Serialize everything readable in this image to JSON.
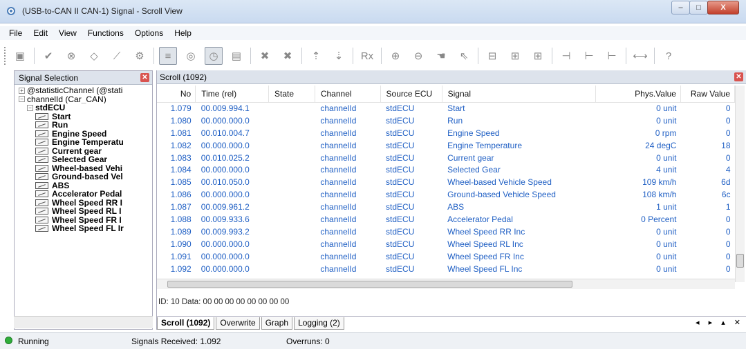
{
  "window": {
    "title": "(USB-to-CAN II  CAN-1) Signal - Scroll View",
    "buttons": [
      "–",
      "□",
      "X"
    ]
  },
  "menu": [
    "File",
    "Edit",
    "View",
    "Functions",
    "Options",
    "Help"
  ],
  "toolbar": [
    {
      "icon": "save-icon",
      "glyph": "▣"
    },
    {
      "icon": "check-icon",
      "glyph": "✔"
    },
    {
      "icon": "stop-icon",
      "glyph": "⊗"
    },
    {
      "icon": "eraser-icon",
      "glyph": "◇"
    },
    {
      "icon": "wand-icon",
      "glyph": "⟋"
    },
    {
      "icon": "tools-icon",
      "glyph": "⚙"
    },
    {
      "icon": "scroll-mode-icon",
      "glyph": "≡",
      "active": true
    },
    {
      "icon": "overwrite-icon",
      "glyph": "◎"
    },
    {
      "icon": "clock-icon",
      "glyph": "◷",
      "active": true
    },
    {
      "icon": "export-icon",
      "glyph": "▤"
    },
    {
      "icon": "delete-icon",
      "glyph": "✖"
    },
    {
      "icon": "delete-all-icon",
      "glyph": "✖"
    },
    {
      "icon": "up-icon",
      "glyph": "⇡"
    },
    {
      "icon": "down-icon",
      "glyph": "⇣"
    },
    {
      "icon": "rx-icon",
      "glyph": "Rx"
    },
    {
      "icon": "zoom-in-icon",
      "glyph": "⊕"
    },
    {
      "icon": "zoom-out-icon",
      "glyph": "⊖"
    },
    {
      "icon": "hand-icon",
      "glyph": "☚"
    },
    {
      "icon": "pointer-icon",
      "glyph": "⇖"
    },
    {
      "icon": "fit-icon",
      "glyph": "⊟"
    },
    {
      "icon": "fit-h-icon",
      "glyph": "⊞"
    },
    {
      "icon": "fit-v-icon",
      "glyph": "⊞"
    },
    {
      "icon": "cursor-icon",
      "glyph": "⊣"
    },
    {
      "icon": "cursor1-icon",
      "glyph": "⊢"
    },
    {
      "icon": "cursor2-icon",
      "glyph": "⊢"
    },
    {
      "icon": "distance-icon",
      "glyph": "⟷"
    },
    {
      "icon": "help-icon",
      "glyph": "?"
    }
  ],
  "left_panel": {
    "title": "Signal Selection",
    "tree": [
      {
        "label": "@statisticChannel  (@stati",
        "level": 0,
        "expander": "+",
        "bold": false
      },
      {
        "label": "channelId  (Car_CAN)",
        "level": 0,
        "expander": "−",
        "bold": false
      },
      {
        "label": "stdECU",
        "level": 1,
        "expander": "−",
        "bold": true
      },
      {
        "label": "Start",
        "level": 2,
        "bold": true
      },
      {
        "label": "Run",
        "level": 2,
        "bold": true
      },
      {
        "label": "Engine Speed",
        "level": 2,
        "bold": true
      },
      {
        "label": "Engine Temperatu",
        "level": 2,
        "bold": true
      },
      {
        "label": "Current gear",
        "level": 2,
        "bold": true
      },
      {
        "label": "Selected Gear",
        "level": 2,
        "bold": true
      },
      {
        "label": "Wheel-based Vehi",
        "level": 2,
        "bold": true
      },
      {
        "label": "Ground-based Vel",
        "level": 2,
        "bold": true
      },
      {
        "label": "ABS",
        "level": 2,
        "bold": true
      },
      {
        "label": "Accelerator Pedal",
        "level": 2,
        "bold": true
      },
      {
        "label": "Wheel Speed RR I",
        "level": 2,
        "bold": true
      },
      {
        "label": "Wheel Speed RL I",
        "level": 2,
        "bold": true
      },
      {
        "label": "Wheel Speed FR I",
        "level": 2,
        "bold": true
      },
      {
        "label": "Wheel Speed FL Ir",
        "level": 2,
        "bold": true
      }
    ],
    "hscroll_label": "III"
  },
  "scroll_panel": {
    "title": "Scroll (1092)",
    "columns": [
      "No",
      "Time (rel)",
      "State",
      "Channel",
      "Source ECU",
      "Signal",
      "Phys.Value",
      "Raw Value"
    ],
    "rows": [
      [
        "1.079",
        "00.009.994.1",
        "",
        "channelId",
        "stdECU",
        "Start",
        "0 unit",
        "0"
      ],
      [
        "1.080",
        "00.000.000.0",
        "",
        "channelId",
        "stdECU",
        "Run",
        "0 unit",
        "0"
      ],
      [
        "1.081",
        "00.010.004.7",
        "",
        "channelId",
        "stdECU",
        "Engine Speed",
        "0 rpm",
        "0"
      ],
      [
        "1.082",
        "00.000.000.0",
        "",
        "channelId",
        "stdECU",
        "Engine Temperature",
        "24 degC",
        "18"
      ],
      [
        "1.083",
        "00.010.025.2",
        "",
        "channelId",
        "stdECU",
        "Current gear",
        "0 unit",
        "0"
      ],
      [
        "1.084",
        "00.000.000.0",
        "",
        "channelId",
        "stdECU",
        "Selected Gear",
        "4 unit",
        "4"
      ],
      [
        "1.085",
        "00.010.050.0",
        "",
        "channelId",
        "stdECU",
        "Wheel-based Vehicle Speed",
        "109 km/h",
        "6d"
      ],
      [
        "1.086",
        "00.000.000.0",
        "",
        "channelId",
        "stdECU",
        "Ground-based Vehicle Speed",
        "108 km/h",
        "6c"
      ],
      [
        "1.087",
        "00.009.961.2",
        "",
        "channelId",
        "stdECU",
        "ABS",
        "1 unit",
        "1"
      ],
      [
        "1.088",
        "00.009.933.6",
        "",
        "channelId",
        "stdECU",
        "Accelerator Pedal",
        "0 Percent",
        "0"
      ],
      [
        "1.089",
        "00.009.993.2",
        "",
        "channelId",
        "stdECU",
        "Wheel Speed RR Inc",
        "0 unit",
        "0"
      ],
      [
        "1.090",
        "00.000.000.0",
        "",
        "channelId",
        "stdECU",
        "Wheel Speed RL Inc",
        "0 unit",
        "0"
      ],
      [
        "1.091",
        "00.000.000.0",
        "",
        "channelId",
        "stdECU",
        "Wheel Speed FR Inc",
        "0 unit",
        "0"
      ],
      [
        "1.092",
        "00.000.000.0",
        "",
        "channelId",
        "stdECU",
        "Wheel Speed FL Inc",
        "0 unit",
        "0"
      ]
    ],
    "hscroll_label": "III",
    "info": "ID: 10   Data:  00 00 00 00 00 00 00 00",
    "tabs": [
      "Scroll (1092)",
      "Overwrite",
      "Graph",
      "Logging (2)"
    ],
    "active_tab": 0,
    "tab_nav": "◂ ▸ ▴ ✕"
  },
  "statusbar": {
    "status": "Running",
    "signals_received": "Signals Received: 1.092",
    "overruns": "Overruns: 0"
  },
  "colors": {
    "row_text": "#1f5fc4",
    "status_ok": "#2fae3a",
    "close_red": "#d9534f"
  }
}
